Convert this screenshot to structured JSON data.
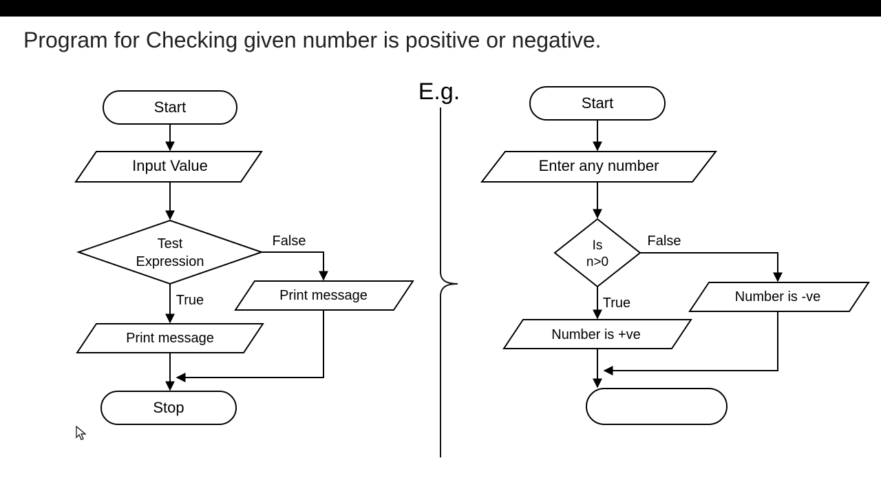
{
  "title": "Program for Checking given number is positive or negative.",
  "eg_label": "E.g.",
  "left": {
    "start": "Start",
    "input": "Input Value",
    "decision_l1": "Test",
    "decision_l2": "Expression",
    "false_label": "False",
    "true_label": "True",
    "print_true": "Print message",
    "print_false": "Print message",
    "stop": "Stop"
  },
  "right": {
    "start": "Start",
    "input": "Enter any number",
    "decision_l1": "Is",
    "decision_l2": "n>0",
    "false_label": "False",
    "true_label": "True",
    "print_true": "Number is +ve",
    "print_false": "Number is -ve",
    "stop": ""
  }
}
